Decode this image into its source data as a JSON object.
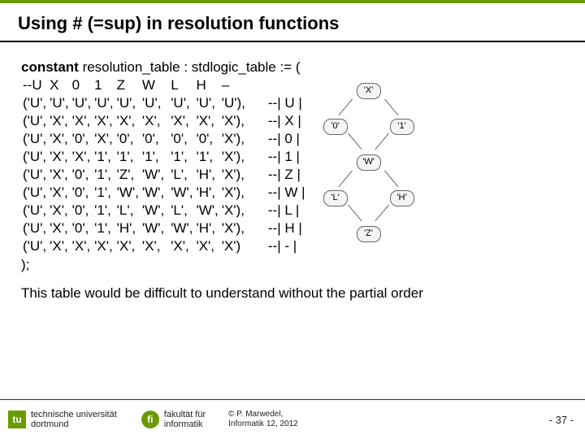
{
  "title": "Using # (=sup) in resolution functions",
  "code_header_parts": [
    "constant",
    " resolution_table : stdlogic_table := ("
  ],
  "cols": [
    "--U",
    "X",
    "0",
    "1",
    "Z",
    "W",
    "",
    "L",
    "H",
    "–"
  ],
  "rows": [
    {
      "cells": [
        "('U',",
        "'U',",
        "'U',",
        "'U',",
        "'U',",
        "'U',",
        "",
        "'U',",
        "'U',",
        "'U'),"
      ],
      "legend": "--| U |"
    },
    {
      "cells": [
        "('U',",
        "'X',",
        "'X',",
        "'X',",
        "'X',",
        "'X',",
        "",
        "'X',",
        "'X',",
        "'X'),"
      ],
      "legend": "--| X |"
    },
    {
      "cells": [
        "('U',",
        "'X',",
        "'0',",
        "'X',",
        "'0',",
        "'0',",
        "",
        "'0',",
        "'0',",
        "'X'),"
      ],
      "legend": "--| 0 |"
    },
    {
      "cells": [
        "('U',",
        "'X',",
        "'X',",
        "'1',",
        "'1',",
        "'1',",
        "",
        "'1',",
        "'1',",
        "'X'),"
      ],
      "legend": "--| 1 |"
    },
    {
      "cells": [
        "('U',",
        "'X',",
        "'0',",
        "'1',",
        "'Z',",
        "'W',",
        "",
        "'L',",
        "'H',",
        "'X'),"
      ],
      "legend": "--| Z |"
    },
    {
      "cells": [
        "('U',",
        "'X',",
        "'0',",
        "'1',",
        "'W',",
        "'W',",
        "",
        "'W',",
        "'H',",
        "'X'),"
      ],
      "legend": "--| W |"
    },
    {
      "cells": [
        "('U',",
        "'X',",
        "'0',",
        "'1',",
        "'L',",
        "'W',",
        "",
        "'L',",
        "'W',",
        "'X'),"
      ],
      "legend": "--| L |"
    },
    {
      "cells": [
        "('U',",
        "'X',",
        "'0',",
        "'1',",
        "'H',",
        "'W',",
        "",
        "'W',",
        "'H',",
        "'X'),"
      ],
      "legend": "--| H |"
    },
    {
      "cells": [
        "('U',",
        "'X',",
        "'X',",
        "'X',",
        "'X',",
        "'X',",
        "",
        "'X',",
        "'X',",
        "'X')"
      ],
      "legend": "--| - |"
    }
  ],
  "code_close": ");",
  "explain": "This table would be difficult to understand without the partial order",
  "diagram_nodes": {
    "x": "'X'",
    "zero": "'0'",
    "one": "'1'",
    "w": "'W'",
    "l": "'L'",
    "h": "'H'",
    "z": "'Z'"
  },
  "footer": {
    "tu": {
      "badge": "tu",
      "l1": "technische universität",
      "l2": "dortmund"
    },
    "fi": {
      "badge": "fi",
      "l1": "fakultät für",
      "l2": "informatik"
    },
    "copy": {
      "l1": "© P. Marwedel,",
      "l2": "Informatik 12,  2012"
    },
    "page": "-  37 -"
  }
}
